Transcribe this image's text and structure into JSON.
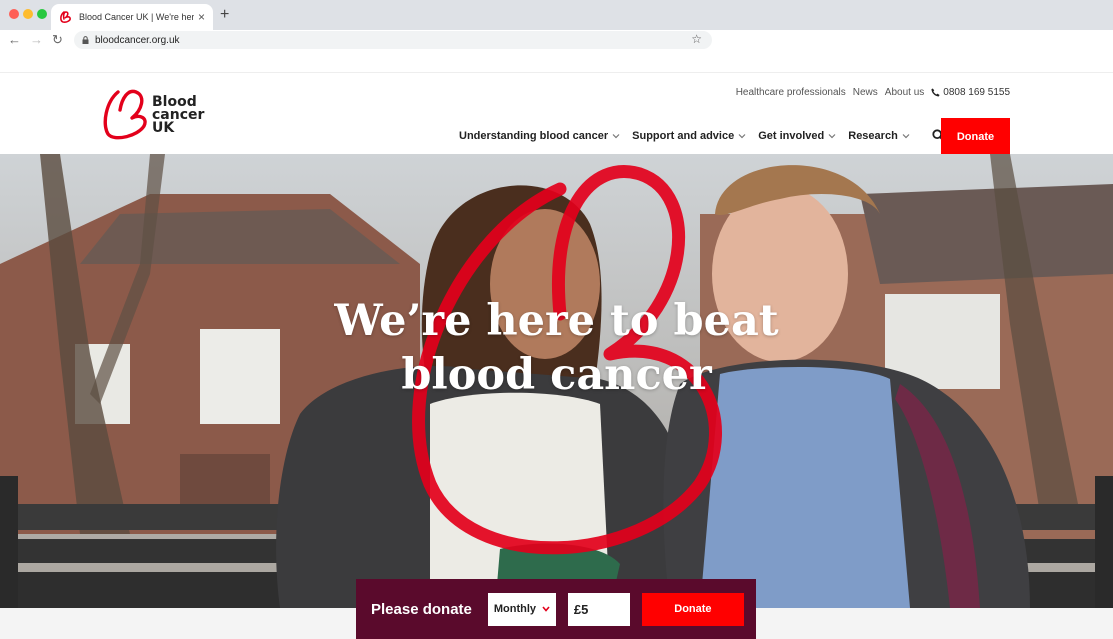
{
  "browser": {
    "tab_title": "Blood Cancer UK | We're here",
    "url": "bloodcancer.org.uk",
    "new_tab_symbol": "+",
    "close_symbol": "×"
  },
  "header": {
    "logo_lines": [
      "Blood",
      "cancer",
      "UK"
    ],
    "utility_links": [
      "Healthcare professionals",
      "News",
      "About us"
    ],
    "phone": "0808 169 5155",
    "nav_items": [
      "Understanding blood cancer",
      "Support and advice",
      "Get involved",
      "Research"
    ],
    "donate_label": "Donate",
    "icons": {
      "search": "search-icon",
      "phone": "phone-icon",
      "chevron": "chevron-down-icon"
    }
  },
  "hero": {
    "title_line1": "We’re here to beat",
    "title_line2": "blood cancer"
  },
  "donate_bar": {
    "label": "Please donate",
    "frequency": "Monthly",
    "amount": "£5",
    "button_label": "Donate"
  },
  "colors": {
    "brand_red": "#ff0000",
    "donate_bar_bg": "#5a0a2c"
  }
}
